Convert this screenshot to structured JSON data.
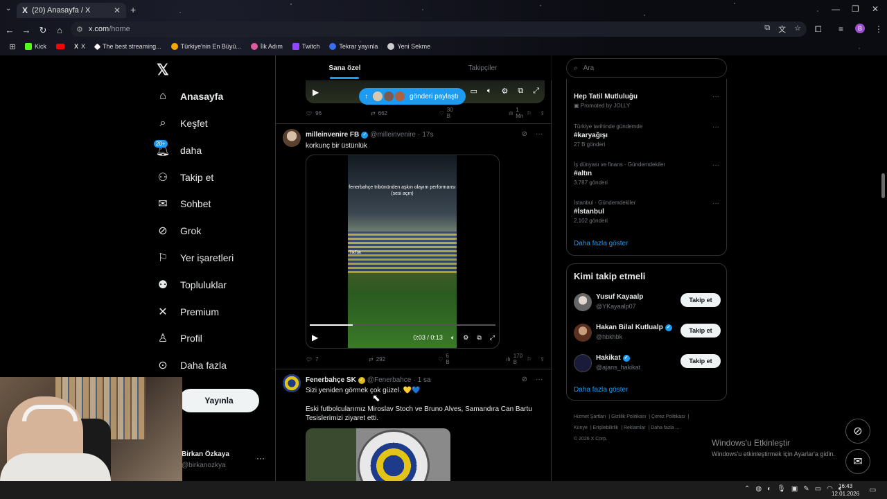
{
  "browser": {
    "tab_title": "(20) Anasayfa / X",
    "tab_icon": "X",
    "url_host": "x.com",
    "url_path": "/home",
    "profile_letter": "B",
    "bookmarks": [
      {
        "label": "Kick",
        "color": "#53fc18"
      },
      {
        "label": "",
        "color": "#ff0000"
      },
      {
        "label": "X",
        "color": "#000000"
      },
      {
        "label": "The best streaming...",
        "color": "#ffffff"
      },
      {
        "label": "Türkiye'nin En Büyü...",
        "color": "#f2a900"
      },
      {
        "label": "İlk Adım",
        "color": "#e05a9e"
      },
      {
        "label": "Twitch",
        "color": "#9146ff"
      },
      {
        "label": "Tekrar yayınla",
        "color": "#3a6df0"
      },
      {
        "label": "Yeni Sekme",
        "color": "#cccccc"
      }
    ]
  },
  "nav": {
    "items": [
      {
        "label": "Anasayfa",
        "icon": "home-icon"
      },
      {
        "label": "Keşfet",
        "icon": "search-icon"
      },
      {
        "label": "daha",
        "icon": "bell-icon",
        "badge": "20+"
      },
      {
        "label": "Takip et",
        "icon": "person-add-icon"
      },
      {
        "label": "Sohbet",
        "icon": "mail-icon"
      },
      {
        "label": "Grok",
        "icon": "grok-icon"
      },
      {
        "label": "Yer işaretleri",
        "icon": "bookmark-icon"
      },
      {
        "label": "Topluluklar",
        "icon": "people-icon"
      },
      {
        "label": "Premium",
        "icon": "x-icon"
      },
      {
        "label": "Profil",
        "icon": "profile-icon"
      },
      {
        "label": "Daha fazla",
        "icon": "more-circle-icon"
      }
    ],
    "post_button": "Yayınla",
    "account_name": "Birkan Özkaya",
    "account_handle": "@birkanozkya"
  },
  "timeline": {
    "tabs": [
      "Sana özel",
      "Takipçiler"
    ],
    "new_posts_pill": "gönderi paylaştı",
    "prev_tweet_stats": {
      "replies": "96",
      "reposts": "662",
      "likes": "30 B",
      "views": "1 Mn"
    },
    "tweets": [
      {
        "name": "milleinvenire FB",
        "handle": "@milleinvenire",
        "time": "17s",
        "text": "korkunç bir üstünlük",
        "video_caption": "fenerbahçe tribününden aşkın olayım performansı (sesi açın)",
        "video_watermark": "TikTok",
        "video_time": "0:03 / 0:13",
        "video_progress": 0.23,
        "stats": {
          "replies": "7",
          "reposts": "292",
          "likes": "6 B",
          "views": "170 B"
        }
      },
      {
        "name": "Fenerbahçe SK",
        "handle": "@Fenerbahce",
        "time": "1 sa",
        "text": "Sizi yeniden görmek çok güzel. 💛💙",
        "text2": "Eski futbolcularımız Miroslav Stoch ve Bruno Alves, Samandıra Can Bartu Tesislerimizi ziyaret etti."
      }
    ]
  },
  "sidebar": {
    "search_placeholder": "Ara",
    "trends": [
      {
        "context": "",
        "title": "Hep Tatil Mutluluğu",
        "count": "Promoted by JOLLY"
      },
      {
        "context": "Türkiye tarihinde gündemde",
        "title": "#karyağışı",
        "count": "27 B gönderi"
      },
      {
        "context": "İş dünyası ve finans · Gündemdekiler",
        "title": "#altın",
        "count": "3.787 gönderi"
      },
      {
        "context": "İstanbul · Gündemdekiler",
        "title": "#İstanbul",
        "count": "2.102 gönderi"
      }
    ],
    "trends_more": "Daha fazla göster",
    "who_to_follow_title": "Kimi takip etmeli",
    "who_to_follow": [
      {
        "name": "Yusuf Kayaalp",
        "handle": "@YKayaalp07",
        "button": "Takip et"
      },
      {
        "name": "Hakan Bilal Kutlualp",
        "handle": "@hbkhbk",
        "button": "Takip et"
      },
      {
        "name": "Hakikat",
        "handle": "@ajans_hakikat",
        "button": "Takip et"
      }
    ],
    "wtf_more": "Daha fazla göster",
    "footer_links": [
      "Hizmet Şartları",
      "Gizlilik Politikası",
      "Çerez Politikası",
      "Künye",
      "Erişilebilirlik",
      "Reklamlar",
      "Daha fazla ...",
      "© 2026 X Corp."
    ]
  },
  "windows": {
    "activation_title": "Windows'u Etkinleştir",
    "activation_sub": "Windows'u etkinleştirmek için Ayarlar'a gidin.",
    "time": "16:43",
    "date": "12.01.2026"
  }
}
